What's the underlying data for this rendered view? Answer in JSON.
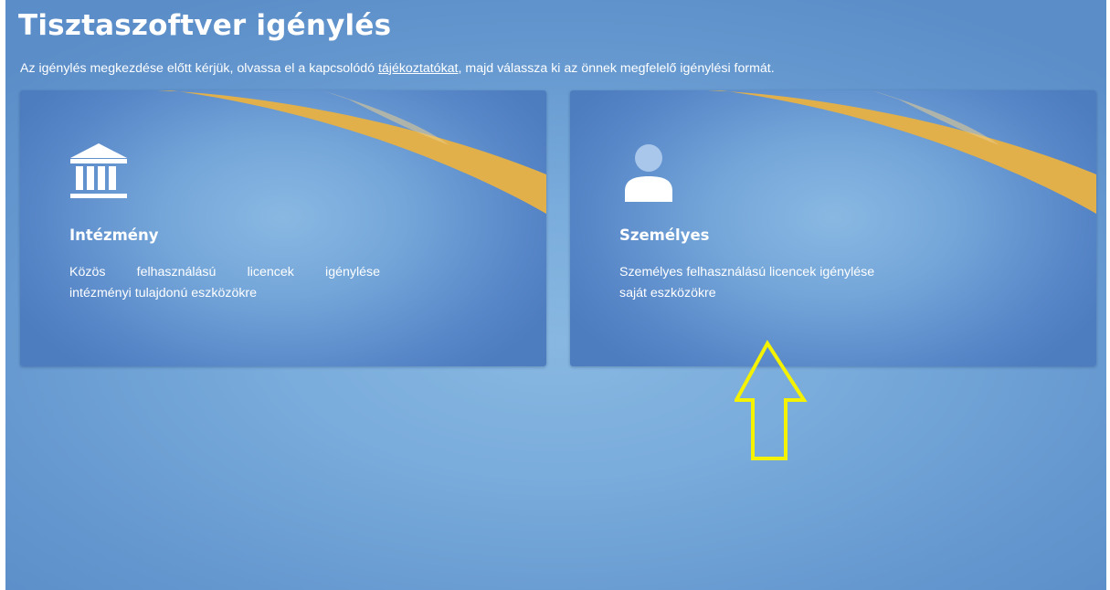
{
  "page": {
    "title": "Tisztaszoftver igénylés",
    "intro": {
      "before": "Az igénylés megkezdése előtt kérjük, olvassa el a kapcsolódó ",
      "link": "tájékoztatókat",
      "after": ", majd válassza ki az önnek megfelelő igénylési formát."
    }
  },
  "cards": [
    {
      "icon": "institution-building-icon",
      "title": "Intézmény",
      "desc_line1": "Közös felhasználású licencek igénylése",
      "desc_line2": "intézményi tulajdonú eszközökre"
    },
    {
      "icon": "user-person-icon",
      "title": "Személyes",
      "desc_line1": "Személyes felhasználású licencek igénylése",
      "desc_line2": "saját eszközökre"
    }
  ],
  "annotation": {
    "icon": "up-arrow-icon",
    "color": "#f5f200"
  },
  "colors": {
    "background": "#7aacdc",
    "card": "#5b8ccb",
    "swoosh": "#e0b24e",
    "text": "#ffffff"
  }
}
